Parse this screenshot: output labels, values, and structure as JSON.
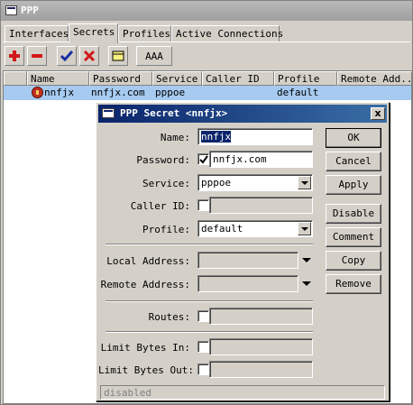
{
  "window": {
    "title": "PPP"
  },
  "tabs": [
    {
      "label": "Interfaces"
    },
    {
      "label": "Secrets",
      "active": true
    },
    {
      "label": "Profiles"
    },
    {
      "label": "Active Connections"
    }
  ],
  "toolbar": {
    "add_icon": "plus-icon",
    "remove_icon": "minus-icon",
    "enable_icon": "check-icon",
    "disable_icon": "x-icon",
    "comment_icon": "note-icon",
    "aaa_label": "AAA"
  },
  "table": {
    "columns": [
      "Name",
      "Password",
      "Service",
      "Caller ID",
      "Profile",
      "Remote Add..."
    ],
    "rows": [
      {
        "name": "nnfjx",
        "password": "nnfjx.com",
        "service": "pppoe",
        "caller_id": "",
        "profile": "default",
        "remote_address": ""
      }
    ]
  },
  "dialog": {
    "title": "PPP Secret <nnfjx>",
    "close_label": "x",
    "fields": {
      "name": {
        "label": "Name:",
        "value": "nnfjx"
      },
      "password": {
        "label": "Password:",
        "value": "nnfjx.com",
        "checked": true
      },
      "service": {
        "label": "Service:",
        "value": "pppoe"
      },
      "caller_id": {
        "label": "Caller ID:",
        "value": ""
      },
      "profile": {
        "label": "Profile:",
        "value": "default"
      },
      "local_address": {
        "label": "Local Address:",
        "value": ""
      },
      "remote_address": {
        "label": "Remote Address:",
        "value": ""
      },
      "routes": {
        "label": "Routes:",
        "value": ""
      },
      "limit_bytes_in": {
        "label": "Limit Bytes In:",
        "value": ""
      },
      "limit_bytes_out": {
        "label": "Limit Bytes Out:",
        "value": ""
      }
    },
    "buttons": {
      "ok": "OK",
      "cancel": "Cancel",
      "apply": "Apply",
      "disable": "Disable",
      "comment": "Comment",
      "copy": "Copy",
      "remove": "Remove"
    },
    "status": "disabled"
  },
  "colors": {
    "selection": "#a6caf0",
    "title_active": "#0a246a",
    "add_icon": "#d01818",
    "check_icon": "#1a2ea0"
  }
}
